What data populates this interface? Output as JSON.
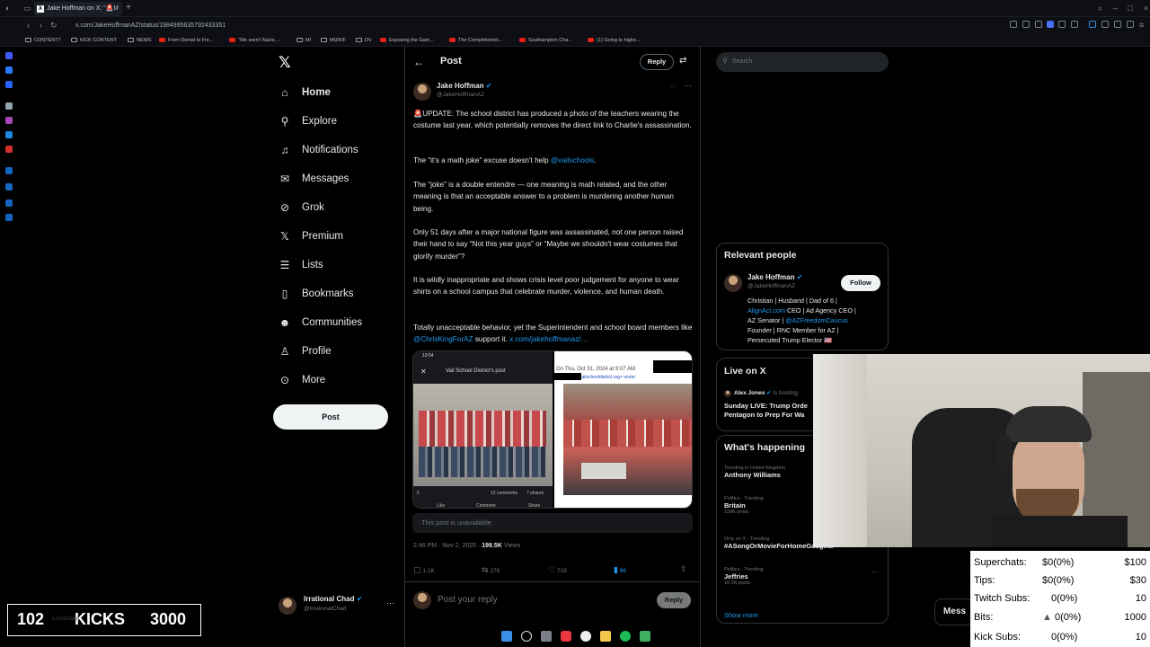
{
  "browser": {
    "tab_title": "Jake Hoffman on X: \"🚨U",
    "url": "x.com/JakeHoffmanAZ/status/1984995635792433351",
    "bookmarks": [
      "CONTENT?",
      "KICK CONTENT",
      "NEWS",
      "From Denial to Fre...",
      "\"We aren't Nazis,...",
      "MI",
      "MIZKIF",
      "DV",
      "Exposing the Gam...",
      "The Completionist...",
      "Southampton Cha...",
      "(1) Going to highs..."
    ]
  },
  "nav": {
    "items": [
      "Home",
      "Explore",
      "Notifications",
      "Messages",
      "Grok",
      "Premium",
      "Lists",
      "Bookmarks",
      "Communities",
      "Profile",
      "More"
    ],
    "post_label": "Post",
    "account_name": "Irrational Chad",
    "account_handle": "@IrrationalChad"
  },
  "post": {
    "header_title": "Post",
    "reply_button": "Reply",
    "author_name": "Jake Hoffman",
    "author_handle": "@JakeHoffmanAZ",
    "p1": "🚨UPDATE: The school district has produced a photo of the teachers wearing the costume last year, which potentially removes the direct link to Charlie's assassination.",
    "p2_pre": "The “it's a math joke” excuse doesn't help ",
    "p2_link": "@vailschools",
    "p2_post": ".",
    "p3": "The “joke” is a double entendre — one meaning is math related, and the other meaning is that an acceptable answer to a problem is murdering another human being.",
    "p4": "Only 51 days after a major national figure was assassinated, not one person raised their hand to say “Not this year guys” or “Maybe we shouldn't wear costumes that glorify murder”?",
    "p5": "It is wildly inappropriate and shows crisis level poor judgement for anyone to wear shirts on a school campus that celebrate murder, violence, and human death.",
    "p6_pre": "Totally unacceptable behavior, yet the Superintendent and school board members like ",
    "p6_link": "@ChrisKingForAZ",
    "p6_mid": " support it. ",
    "p6_link2": "x.com/jakehoffmanaz/…",
    "img_left_time": "10:54",
    "img_left_title": "Vail School District's post",
    "img_left_comments": "12 comments",
    "img_left_shares": "7 shares",
    "img_left_count": "5",
    "img_left_like": "Like",
    "img_left_comment": "Comment",
    "img_left_share": "Share",
    "img_right_caption": "On Thu, Oct 31, 2024 at 9:07 AM",
    "img_right_email": "vailschooldistrict.org> wrote:",
    "unavailable": "This post is unavailable.",
    "timestamp": "2:46 PM · Nov 2, 2025 · ",
    "views_count": "199.5K",
    "views_label": " Views",
    "replies": "1.1K",
    "reposts": "279",
    "likes": "719",
    "bookmarks": "66",
    "reply_placeholder": "Post your reply",
    "reply_submit": "Reply"
  },
  "right": {
    "search_placeholder": "Search",
    "relevant_title": "Relevant people",
    "rp_name": "Jake Hoffman",
    "rp_handle": "@JakeHoffmanAZ",
    "follow": "Follow",
    "bio_1": "Christian | Husband | Dad of 6 |",
    "bio_2_link": "AlignAct.com",
    "bio_2_post": " CEO | Ad Agency CEO |",
    "bio_3_pre": "AZ Senator | ",
    "bio_3_link": "@AZFreedomCaucus",
    "bio_4": "Founder | RNC Member for AZ |",
    "bio_5": "Persecuted Trump Elector 🇺🇸",
    "live_title": "Live on X",
    "live_host": "Alex Jones",
    "live_hosting": " is hosting",
    "live_line1": "Sunday LIVE: Trump Orde",
    "live_line2": "Pentagon to Prep For Wa",
    "happening_title": "What's happening",
    "trends": [
      {
        "meta": "Trending in United Kingdom",
        "name": "Anthony Williams",
        "sub": ""
      },
      {
        "meta": "Politics · Trending",
        "name": "Britain",
        "sub": "128K posts"
      },
      {
        "meta": "Only on X · Trending",
        "name": "#ASongOrMovieForHomeGadgets",
        "sub": ""
      },
      {
        "meta": "Politics · Trending",
        "name": "Jeffries",
        "sub": "16.2K posts"
      }
    ],
    "show_more": "Show more",
    "messages_peek": "Mess"
  },
  "stream": {
    "stats": [
      {
        "label": "Superchats:",
        "value": "$0(0%)",
        "goal": "$100"
      },
      {
        "label": "Tips:",
        "value": "$0(0%)",
        "goal": "$30"
      },
      {
        "label": "Twitch Subs:",
        "value": "0(0%)",
        "goal": "10"
      },
      {
        "label": "Bits:",
        "value": "0(0%)",
        "goal": "1000"
      },
      {
        "label": "Kick Subs:",
        "value": "0(0%)",
        "goal": "10"
      }
    ],
    "kicks_current": "102",
    "kicks_label": "KICKS",
    "kicks_goal": "3000",
    "status_url": "x.com/Jake"
  }
}
